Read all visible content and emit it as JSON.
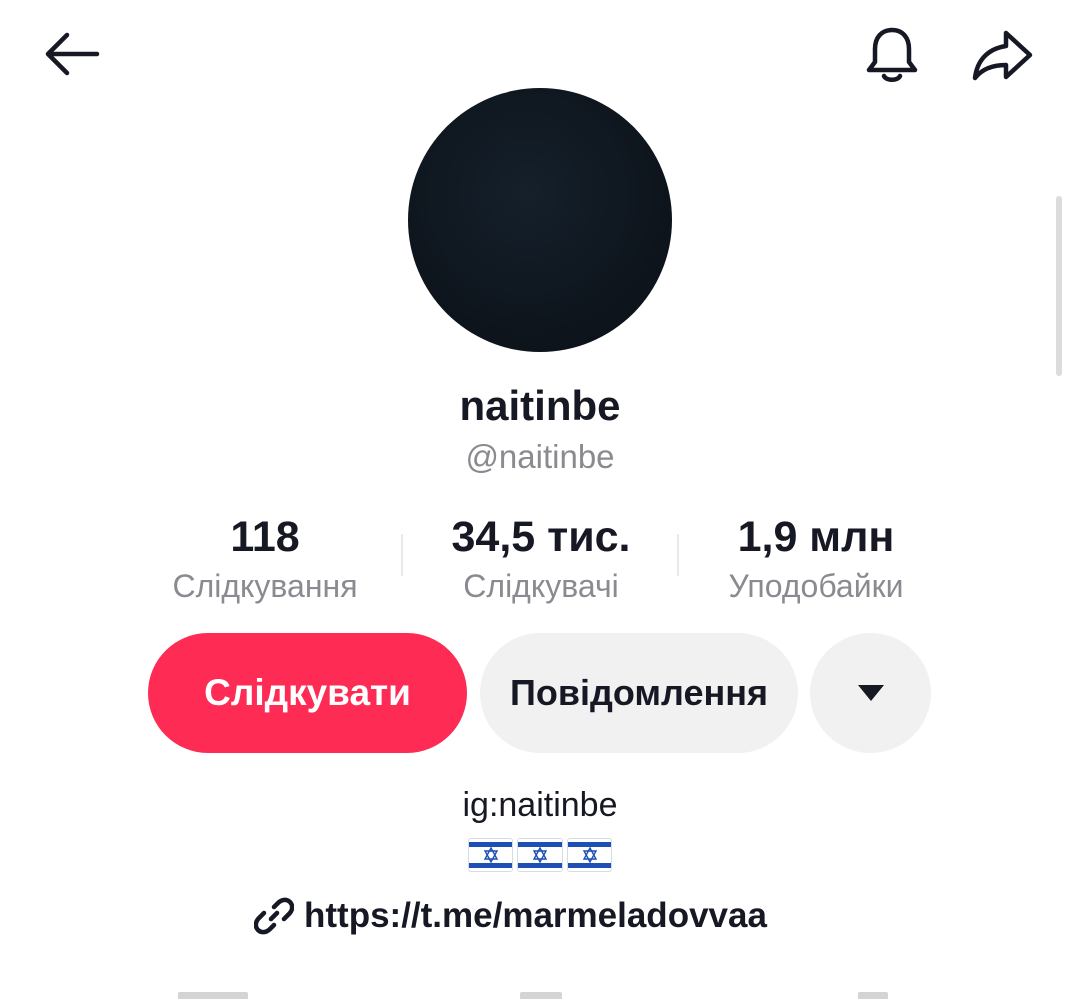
{
  "profile": {
    "display_name": "naitinbe",
    "handle": "@naitinbe"
  },
  "stats": {
    "following": {
      "value": "118",
      "label": "Слідкування"
    },
    "followers": {
      "value": "34,5 тис.",
      "label": "Слідкувачі"
    },
    "likes": {
      "value": "1,9 млн",
      "label": "Уподобайки"
    }
  },
  "actions": {
    "follow_label": "Слідкувати",
    "message_label": "Повідомлення"
  },
  "bio": {
    "line1": "ig:naitinbe",
    "flags": [
      "israel-flag",
      "israel-flag",
      "israel-flag"
    ],
    "link": "https://t.me/marmeladovvaa"
  },
  "icons": {
    "back": "arrow-left-icon",
    "notifications": "bell-icon",
    "share": "share-arrow-icon",
    "more": "caret-down-icon",
    "link": "link-icon"
  },
  "colors": {
    "accent": "#fe2c55",
    "secondary_button": "#f1f1f2",
    "muted_text": "#8a8b91"
  }
}
